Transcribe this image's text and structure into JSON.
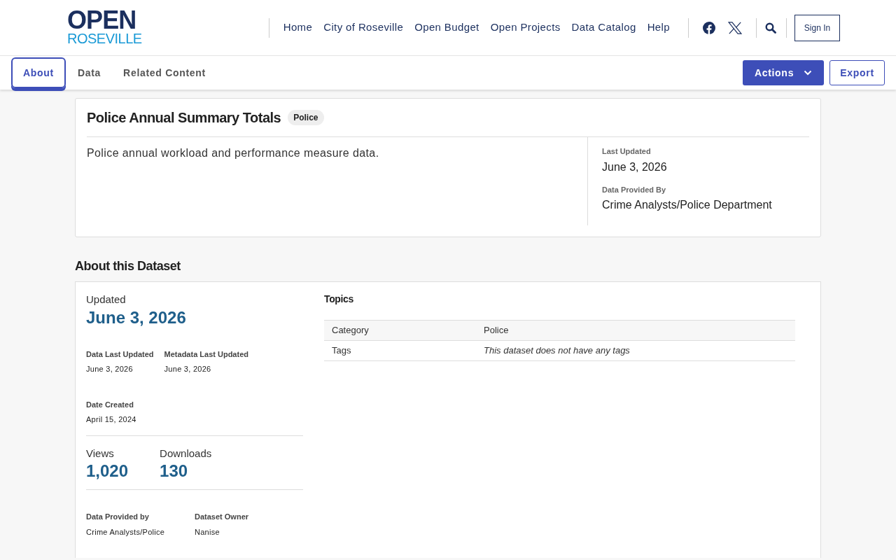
{
  "logo": {
    "top": "OPEN",
    "bottom": "ROSEVILLE"
  },
  "nav": [
    {
      "label": "Home"
    },
    {
      "label": "City of Roseville"
    },
    {
      "label": "Open Budget"
    },
    {
      "label": "Open Projects"
    },
    {
      "label": "Data Catalog"
    },
    {
      "label": "Help"
    }
  ],
  "sign_in": "Sign In",
  "tabs": [
    {
      "label": "About",
      "selected": true
    },
    {
      "label": "Data",
      "selected": false
    },
    {
      "label": "Related Content",
      "selected": false
    }
  ],
  "actions": {
    "label": "Actions"
  },
  "export": {
    "label": "Export"
  },
  "summary": {
    "title": "Police Annual Summary Totals",
    "badge": "Police",
    "description": "Police annual workload and performance measure data.",
    "meta": [
      {
        "label": "Last Updated",
        "value": "June 3, 2026"
      },
      {
        "label": "Data Provided By",
        "value": "Crime Analysts/Police Department"
      }
    ]
  },
  "about": {
    "heading": "About this Dataset",
    "updated_label": "Updated",
    "updated_value": "June 3, 2026",
    "dates": [
      {
        "label": "Data Last Updated",
        "value": "June 3, 2026"
      },
      {
        "label": "Metadata Last Updated",
        "value": "June 3, 2026"
      }
    ],
    "created": {
      "label": "Date Created",
      "value": "April 15, 2024"
    },
    "stats": [
      {
        "label": "Views",
        "value": "1,020"
      },
      {
        "label": "Downloads",
        "value": "130"
      }
    ],
    "people": [
      {
        "label": "Data Provided by",
        "value": "Crime Analysts/Police"
      },
      {
        "label": "Dataset Owner",
        "value": "Nanise"
      }
    ],
    "topics": {
      "heading": "Topics",
      "rows": [
        {
          "key": "Category",
          "value": "Police",
          "italic": false
        },
        {
          "key": "Tags",
          "value": "This dataset does not have any tags",
          "italic": true
        }
      ]
    }
  }
}
